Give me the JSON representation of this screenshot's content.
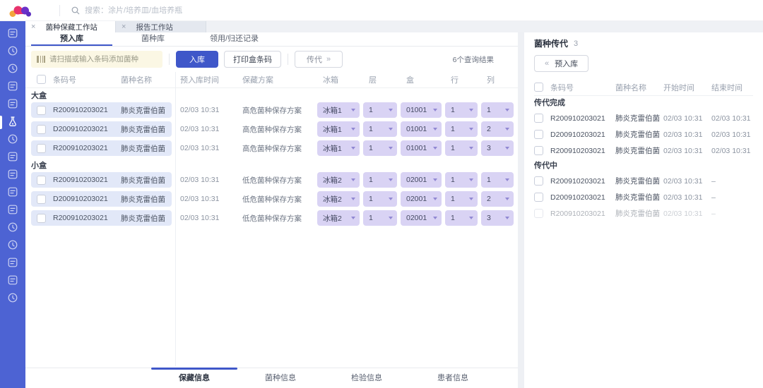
{
  "topbar": {
    "search_placeholder": "搜索：涂片/培养皿/血培养瓶"
  },
  "sidebar": {
    "icons": [
      {
        "name": "task-check"
      },
      {
        "name": "clock"
      },
      {
        "name": "cloud-data"
      },
      {
        "name": "image-frame"
      },
      {
        "name": "id-card"
      },
      {
        "name": "flask",
        "active": true
      },
      {
        "name": "compass"
      },
      {
        "name": "document-check"
      },
      {
        "name": "box-clock"
      },
      {
        "name": "barcode-grid"
      },
      {
        "name": "document-chart"
      },
      {
        "name": "user-head"
      },
      {
        "name": "chat-bubble"
      },
      {
        "name": "card-plus"
      },
      {
        "name": "archive-box"
      },
      {
        "name": "pie-chart"
      }
    ]
  },
  "tabs": [
    {
      "label": "菌种保藏工作站",
      "active": true
    },
    {
      "label": "报告工作站",
      "active": false
    }
  ],
  "subtabs": [
    {
      "label": "预入库",
      "active": true
    },
    {
      "label": "菌种库",
      "active": false
    },
    {
      "label": "领用/归还记录",
      "active": false
    }
  ],
  "toolbar": {
    "scan_placeholder": "请扫描或输入条码添加菌种",
    "stock_in_label": "入库",
    "print_label": "打印盒条码",
    "passage_label": "传代",
    "passage_chevron": "»",
    "results_count": "6个查询结果"
  },
  "left_table": {
    "headers": [
      "条码号",
      "菌种名称",
      "预入库时间",
      "保藏方案",
      "冰箱",
      "层",
      "盒",
      "行",
      "列"
    ],
    "groups": [
      {
        "label": "大盒",
        "rows": [
          {
            "barcode": "R200910203021",
            "name": "肺炎克雷伯菌",
            "time": "02/03 10:31",
            "plan": "高危菌种保存方案",
            "fridge": "冰箱1",
            "layer": "1",
            "box": "01001",
            "row": "1",
            "col": "1"
          },
          {
            "barcode": "D200910203021",
            "name": "肺炎克雷伯菌",
            "time": "02/03 10:31",
            "plan": "高危菌种保存方案",
            "fridge": "冰箱1",
            "layer": "1",
            "box": "01001",
            "row": "1",
            "col": "2"
          },
          {
            "barcode": "R200910203021",
            "name": "肺炎克雷伯菌",
            "time": "02/03 10:31",
            "plan": "高危菌种保存方案",
            "fridge": "冰箱1",
            "layer": "1",
            "box": "01001",
            "row": "1",
            "col": "3"
          }
        ]
      },
      {
        "label": "小盒",
        "rows": [
          {
            "barcode": "R200910203021",
            "name": "肺炎克雷伯菌",
            "time": "02/03 10:31",
            "plan": "低危菌种保存方案",
            "fridge": "冰箱2",
            "layer": "1",
            "box": "02001",
            "row": "1",
            "col": "1"
          },
          {
            "barcode": "D200910203021",
            "name": "肺炎克雷伯菌",
            "time": "02/03 10:31",
            "plan": "低危菌种保存方案",
            "fridge": "冰箱2",
            "layer": "1",
            "box": "02001",
            "row": "1",
            "col": "2"
          },
          {
            "barcode": "R200910203021",
            "name": "肺炎克雷伯菌",
            "time": "02/03 10:31",
            "plan": "低危菌种保存方案",
            "fridge": "冰箱2",
            "layer": "1",
            "box": "02001",
            "row": "1",
            "col": "3"
          }
        ]
      }
    ]
  },
  "bottom_tabs": [
    {
      "label": "保藏信息",
      "active": true
    },
    {
      "label": "菌种信息",
      "active": false
    },
    {
      "label": "检验信息",
      "active": false
    },
    {
      "label": "患者信息",
      "active": false
    }
  ],
  "right_panel": {
    "title": "菌种传代",
    "count": "3",
    "back_chevron": "«",
    "back_label": "预入库",
    "headers": [
      "条码号",
      "菌种名称",
      "开始时间",
      "结束时间"
    ],
    "groups": [
      {
        "label": "传代完成",
        "rows": [
          {
            "barcode": "R200910203021",
            "name": "肺炎克雷伯菌",
            "start": "02/03 10:31",
            "end": "02/03 10:31"
          },
          {
            "barcode": "D200910203021",
            "name": "肺炎克雷伯菌",
            "start": "02/03 10:31",
            "end": "02/03 10:31"
          },
          {
            "barcode": "R200910203021",
            "name": "肺炎克雷伯菌",
            "start": "02/03 10:31",
            "end": "02/03 10:31"
          }
        ]
      },
      {
        "label": "传代中",
        "rows": [
          {
            "barcode": "R200910203021",
            "name": "肺炎克雷伯菌",
            "start": "02/03 10:31",
            "end": "–"
          },
          {
            "barcode": "D200910203021",
            "name": "肺炎克雷伯菌",
            "start": "02/03 10:31",
            "end": "–"
          },
          {
            "barcode": "R200910203021",
            "name": "肺炎克雷伯菌",
            "start": "02/03 10:31",
            "end": "–",
            "faded": true
          }
        ]
      }
    ]
  },
  "colors": {
    "primary_blue": "#3f57c9",
    "sidebar_blue": "#4d63d3",
    "chip_lavender": "#d9d3f4",
    "row_blue": "#e2e8f8",
    "scan_yellow": "#fbf7e4"
  }
}
